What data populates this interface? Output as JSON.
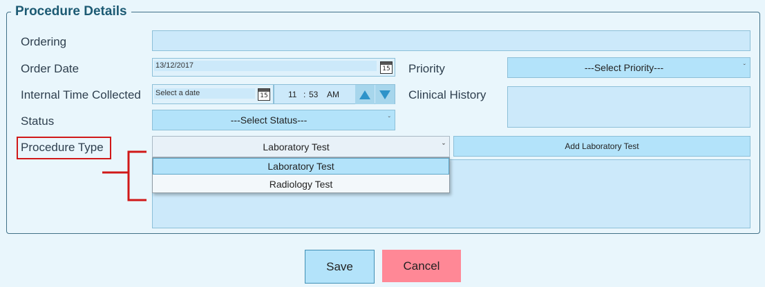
{
  "section": {
    "title": "Procedure Details"
  },
  "form": {
    "ordering": {
      "label": "Ordering",
      "value": ""
    },
    "order_date": {
      "label": "Order Date",
      "value": "13/12/2017",
      "calendar_day": "15"
    },
    "priority": {
      "label": "Priority",
      "selected": "---Select Priority---"
    },
    "internal_time": {
      "label": "Internal Time Collected",
      "date_placeholder": "Select a date",
      "calendar_day": "15",
      "hour": "11",
      "separator": ":",
      "minute": "53",
      "ampm": "AM"
    },
    "clinical_history": {
      "label": "Clinical History",
      "value": ""
    },
    "status": {
      "label": "Status",
      "selected": "---Select Status---"
    },
    "procedure_type": {
      "label": "Procedure Type",
      "selected": "Laboratory Test",
      "options": [
        "Laboratory Test",
        "Radiology Test"
      ],
      "highlighted_index": 0
    },
    "add_button": {
      "label": "Add Laboratory Test"
    }
  },
  "actions": {
    "save": "Save",
    "cancel": "Cancel"
  },
  "colors": {
    "title": "#1c5a73",
    "input_bg": "#cce9fa",
    "select_bg": "#b3e3fa",
    "save_bg": "#b3e3fa",
    "cancel_bg": "#ff8896",
    "annotation": "#d01818"
  },
  "icons": {
    "calendar": "calendar-icon",
    "dropdown": "chevron-down-icon",
    "spin_up": "triangle-up-icon",
    "spin_down": "triangle-down-icon"
  }
}
